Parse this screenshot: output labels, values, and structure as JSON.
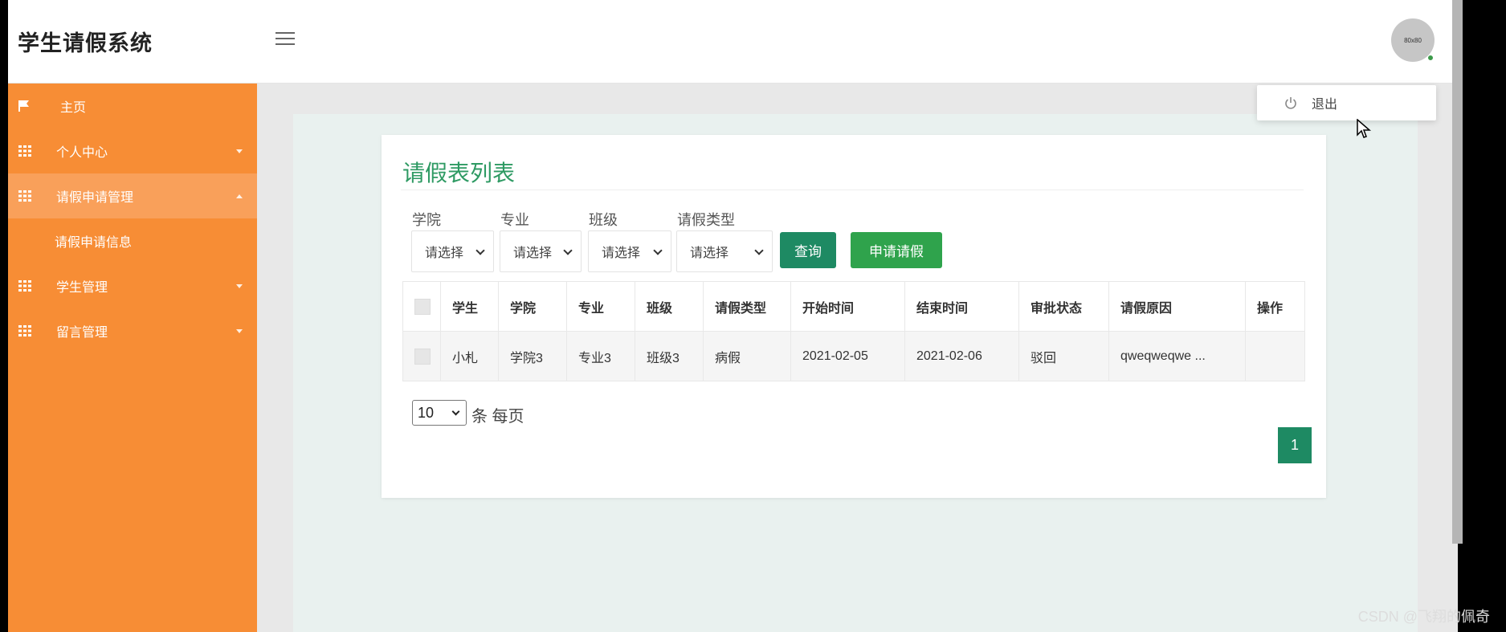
{
  "app_title": "学生请假系统",
  "header": {
    "avatar_text": "80x80"
  },
  "user_menu": {
    "logout_label": "退出"
  },
  "sidebar": {
    "items": [
      {
        "label": "主页",
        "icon": "flag-icon"
      },
      {
        "label": "个人中心",
        "icon": "grid-icon"
      },
      {
        "label": "请假申请管理",
        "icon": "grid-icon",
        "expanded": true,
        "children": [
          {
            "label": "请假申请信息"
          }
        ]
      },
      {
        "label": "学生管理",
        "icon": "grid-icon"
      },
      {
        "label": "留言管理",
        "icon": "grid-icon"
      }
    ]
  },
  "main": {
    "title": "请假表列表",
    "filters": [
      {
        "label": "学院",
        "value": "请选择"
      },
      {
        "label": "专业",
        "value": "请选择"
      },
      {
        "label": "班级",
        "value": "请选择"
      },
      {
        "label": "请假类型",
        "value": "请选择"
      }
    ],
    "buttons": {
      "query": "查询",
      "apply": "申请请假"
    },
    "table": {
      "headers": [
        "学生",
        "学院",
        "专业",
        "班级",
        "请假类型",
        "开始时间",
        "结束时间",
        "审批状态",
        "请假原因",
        "操作"
      ],
      "rows": [
        [
          "小札",
          "学院3",
          "专业3",
          "班级3",
          "病假",
          "2021-02-05",
          "2021-02-06",
          "驳回",
          "qweqweqwe ...",
          ""
        ]
      ]
    },
    "pagination": {
      "page_size": "10",
      "per_page_label": "条 每页",
      "current_page": "1"
    }
  },
  "watermark": "CSDN @飞翔的佩奇",
  "colors": {
    "sidebar": "#f78d35",
    "accent_green": "#1e8a63",
    "apply_green": "#2fa34c",
    "title_green": "#2e9a63"
  }
}
